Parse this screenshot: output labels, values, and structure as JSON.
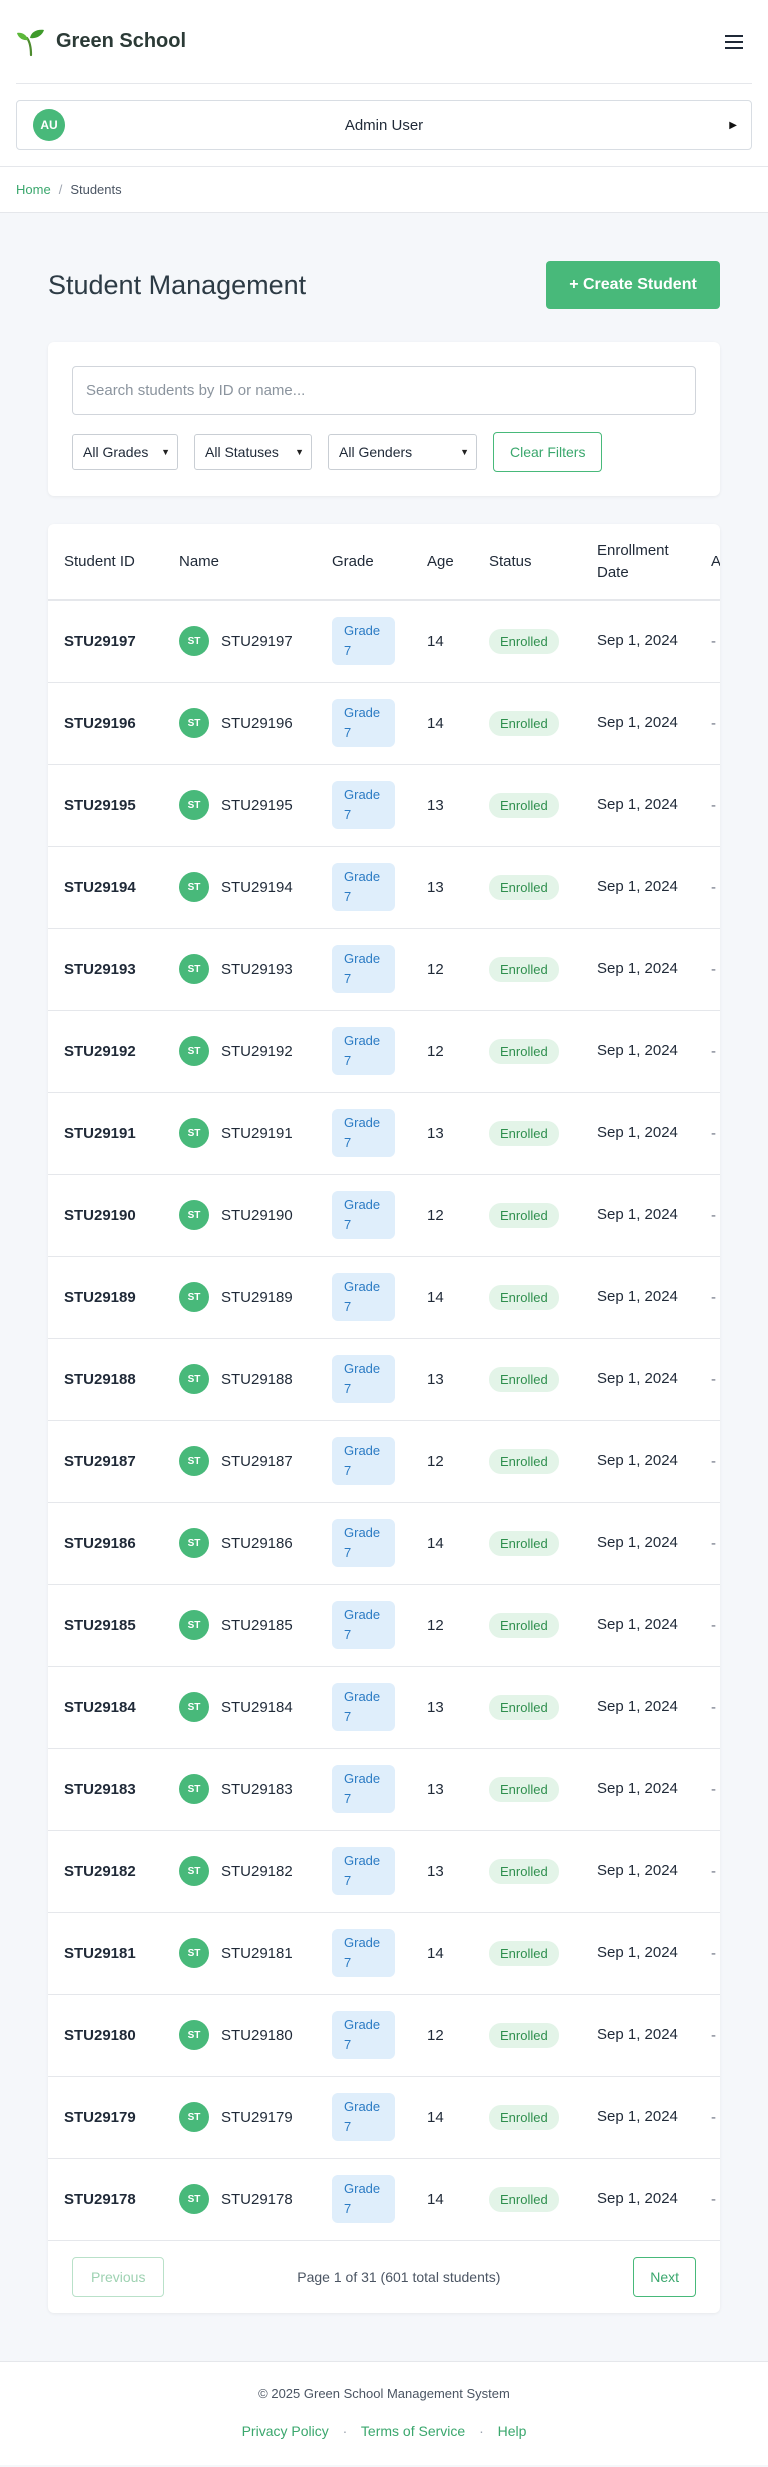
{
  "brand": {
    "name": "Green School",
    "logo_icon": "sprout-icon",
    "accent": "#48b97a"
  },
  "user": {
    "initials": "AU",
    "name": "Admin User"
  },
  "breadcrumb": {
    "home": "Home",
    "current": "Students"
  },
  "page": {
    "title": "Student Management",
    "create_label": "+ Create Student"
  },
  "filters": {
    "search_placeholder": "Search students by ID or name...",
    "grade": "All Grades",
    "status": "All Statuses",
    "gender": "All Genders",
    "clear_label": "Clear Filters"
  },
  "table": {
    "headers": [
      "Student ID",
      "Name",
      "Grade",
      "Age",
      "Status",
      "Enrollment Date",
      "A"
    ],
    "rows": [
      {
        "id": "STU29197",
        "initials": "ST",
        "name": "STU29197",
        "grade": "Grade 7",
        "age": "14",
        "status": "Enrolled",
        "date": "Sep 1, 2024",
        "action": "-"
      },
      {
        "id": "STU29196",
        "initials": "ST",
        "name": "STU29196",
        "grade": "Grade 7",
        "age": "14",
        "status": "Enrolled",
        "date": "Sep 1, 2024",
        "action": "-"
      },
      {
        "id": "STU29195",
        "initials": "ST",
        "name": "STU29195",
        "grade": "Grade 7",
        "age": "13",
        "status": "Enrolled",
        "date": "Sep 1, 2024",
        "action": "-"
      },
      {
        "id": "STU29194",
        "initials": "ST",
        "name": "STU29194",
        "grade": "Grade 7",
        "age": "13",
        "status": "Enrolled",
        "date": "Sep 1, 2024",
        "action": "-"
      },
      {
        "id": "STU29193",
        "initials": "ST",
        "name": "STU29193",
        "grade": "Grade 7",
        "age": "12",
        "status": "Enrolled",
        "date": "Sep 1, 2024",
        "action": "-"
      },
      {
        "id": "STU29192",
        "initials": "ST",
        "name": "STU29192",
        "grade": "Grade 7",
        "age": "12",
        "status": "Enrolled",
        "date": "Sep 1, 2024",
        "action": "-"
      },
      {
        "id": "STU29191",
        "initials": "ST",
        "name": "STU29191",
        "grade": "Grade 7",
        "age": "13",
        "status": "Enrolled",
        "date": "Sep 1, 2024",
        "action": "-"
      },
      {
        "id": "STU29190",
        "initials": "ST",
        "name": "STU29190",
        "grade": "Grade 7",
        "age": "12",
        "status": "Enrolled",
        "date": "Sep 1, 2024",
        "action": "-"
      },
      {
        "id": "STU29189",
        "initials": "ST",
        "name": "STU29189",
        "grade": "Grade 7",
        "age": "14",
        "status": "Enrolled",
        "date": "Sep 1, 2024",
        "action": "-"
      },
      {
        "id": "STU29188",
        "initials": "ST",
        "name": "STU29188",
        "grade": "Grade 7",
        "age": "13",
        "status": "Enrolled",
        "date": "Sep 1, 2024",
        "action": "-"
      },
      {
        "id": "STU29187",
        "initials": "ST",
        "name": "STU29187",
        "grade": "Grade 7",
        "age": "12",
        "status": "Enrolled",
        "date": "Sep 1, 2024",
        "action": "-"
      },
      {
        "id": "STU29186",
        "initials": "ST",
        "name": "STU29186",
        "grade": "Grade 7",
        "age": "14",
        "status": "Enrolled",
        "date": "Sep 1, 2024",
        "action": "-"
      },
      {
        "id": "STU29185",
        "initials": "ST",
        "name": "STU29185",
        "grade": "Grade 7",
        "age": "12",
        "status": "Enrolled",
        "date": "Sep 1, 2024",
        "action": "-"
      },
      {
        "id": "STU29184",
        "initials": "ST",
        "name": "STU29184",
        "grade": "Grade 7",
        "age": "13",
        "status": "Enrolled",
        "date": "Sep 1, 2024",
        "action": "-"
      },
      {
        "id": "STU29183",
        "initials": "ST",
        "name": "STU29183",
        "grade": "Grade 7",
        "age": "13",
        "status": "Enrolled",
        "date": "Sep 1, 2024",
        "action": "-"
      },
      {
        "id": "STU29182",
        "initials": "ST",
        "name": "STU29182",
        "grade": "Grade 7",
        "age": "13",
        "status": "Enrolled",
        "date": "Sep 1, 2024",
        "action": "-"
      },
      {
        "id": "STU29181",
        "initials": "ST",
        "name": "STU29181",
        "grade": "Grade 7",
        "age": "14",
        "status": "Enrolled",
        "date": "Sep 1, 2024",
        "action": "-"
      },
      {
        "id": "STU29180",
        "initials": "ST",
        "name": "STU29180",
        "grade": "Grade 7",
        "age": "12",
        "status": "Enrolled",
        "date": "Sep 1, 2024",
        "action": "-"
      },
      {
        "id": "STU29179",
        "initials": "ST",
        "name": "STU29179",
        "grade": "Grade 7",
        "age": "14",
        "status": "Enrolled",
        "date": "Sep 1, 2024",
        "action": "-"
      },
      {
        "id": "STU29178",
        "initials": "ST",
        "name": "STU29178",
        "grade": "Grade 7",
        "age": "14",
        "status": "Enrolled",
        "date": "Sep 1, 2024",
        "action": "-"
      }
    ]
  },
  "pagination": {
    "prev_label": "Previous",
    "info": "Page 1 of 31 (601 total students)",
    "next_label": "Next"
  },
  "footer": {
    "copyright": "© 2025 Green School Management System",
    "links": [
      "Privacy Policy",
      "Terms of Service",
      "Help"
    ]
  }
}
